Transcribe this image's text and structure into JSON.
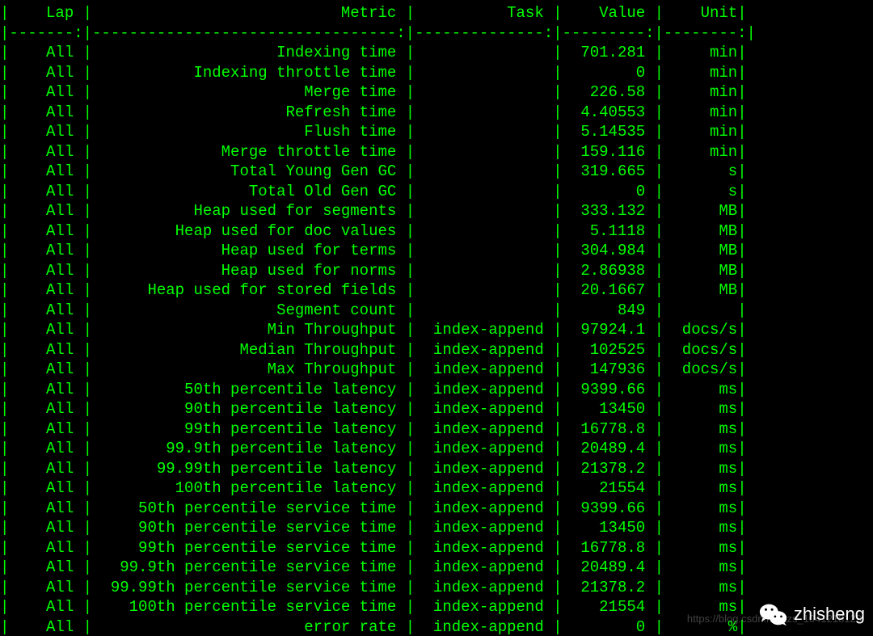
{
  "columns": {
    "lap": {
      "header": "Lap",
      "width": 7,
      "pad_right": 1
    },
    "metric": {
      "header": "Metric",
      "width": 33,
      "pad_right": 1
    },
    "task": {
      "header": "Task",
      "width": 14,
      "pad_right": 1
    },
    "value": {
      "header": "Value",
      "width": 9,
      "pad_right": 1
    },
    "unit": {
      "header": "Unit",
      "width": 8,
      "pad_right": 0
    }
  },
  "rows": [
    {
      "lap": "All",
      "metric": "Indexing time",
      "task": "",
      "value": "701.281",
      "unit": "min"
    },
    {
      "lap": "All",
      "metric": "Indexing throttle time",
      "task": "",
      "value": "0",
      "unit": "min"
    },
    {
      "lap": "All",
      "metric": "Merge time",
      "task": "",
      "value": "226.58",
      "unit": "min"
    },
    {
      "lap": "All",
      "metric": "Refresh time",
      "task": "",
      "value": "4.40553",
      "unit": "min"
    },
    {
      "lap": "All",
      "metric": "Flush time",
      "task": "",
      "value": "5.14535",
      "unit": "min"
    },
    {
      "lap": "All",
      "metric": "Merge throttle time",
      "task": "",
      "value": "159.116",
      "unit": "min"
    },
    {
      "lap": "All",
      "metric": "Total Young Gen GC",
      "task": "",
      "value": "319.665",
      "unit": "s"
    },
    {
      "lap": "All",
      "metric": "Total Old Gen GC",
      "task": "",
      "value": "0",
      "unit": "s"
    },
    {
      "lap": "All",
      "metric": "Heap used for segments",
      "task": "",
      "value": "333.132",
      "unit": "MB"
    },
    {
      "lap": "All",
      "metric": "Heap used for doc values",
      "task": "",
      "value": "5.1118",
      "unit": "MB"
    },
    {
      "lap": "All",
      "metric": "Heap used for terms",
      "task": "",
      "value": "304.984",
      "unit": "MB"
    },
    {
      "lap": "All",
      "metric": "Heap used for norms",
      "task": "",
      "value": "2.86938",
      "unit": "MB"
    },
    {
      "lap": "All",
      "metric": "Heap used for stored fields",
      "task": "",
      "value": "20.1667",
      "unit": "MB"
    },
    {
      "lap": "All",
      "metric": "Segment count",
      "task": "",
      "value": "849",
      "unit": ""
    },
    {
      "lap": "All",
      "metric": "Min Throughput",
      "task": "index-append",
      "value": "97924.1",
      "unit": "docs/s"
    },
    {
      "lap": "All",
      "metric": "Median Throughput",
      "task": "index-append",
      "value": "102525",
      "unit": "docs/s"
    },
    {
      "lap": "All",
      "metric": "Max Throughput",
      "task": "index-append",
      "value": "147936",
      "unit": "docs/s"
    },
    {
      "lap": "All",
      "metric": "50th percentile latency",
      "task": "index-append",
      "value": "9399.66",
      "unit": "ms"
    },
    {
      "lap": "All",
      "metric": "90th percentile latency",
      "task": "index-append",
      "value": "13450",
      "unit": "ms"
    },
    {
      "lap": "All",
      "metric": "99th percentile latency",
      "task": "index-append",
      "value": "16778.8",
      "unit": "ms"
    },
    {
      "lap": "All",
      "metric": "99.9th percentile latency",
      "task": "index-append",
      "value": "20489.4",
      "unit": "ms"
    },
    {
      "lap": "All",
      "metric": "99.99th percentile latency",
      "task": "index-append",
      "value": "21378.2",
      "unit": "ms"
    },
    {
      "lap": "All",
      "metric": "100th percentile latency",
      "task": "index-append",
      "value": "21554",
      "unit": "ms"
    },
    {
      "lap": "All",
      "metric": "50th percentile service time",
      "task": "index-append",
      "value": "9399.66",
      "unit": "ms"
    },
    {
      "lap": "All",
      "metric": "90th percentile service time",
      "task": "index-append",
      "value": "13450",
      "unit": "ms"
    },
    {
      "lap": "All",
      "metric": "99th percentile service time",
      "task": "index-append",
      "value": "16778.8",
      "unit": "ms"
    },
    {
      "lap": "All",
      "metric": "99.9th percentile service time",
      "task": "index-append",
      "value": "20489.4",
      "unit": "ms"
    },
    {
      "lap": "All",
      "metric": "99.99th percentile service time",
      "task": "index-append",
      "value": "21378.2",
      "unit": "ms"
    },
    {
      "lap": "All",
      "metric": "100th percentile service time",
      "task": "index-append",
      "value": "21554",
      "unit": "ms"
    },
    {
      "lap": "All",
      "metric": "error rate",
      "task": "index-append",
      "value": "0",
      "unit": "%"
    }
  ],
  "watermark": {
    "label": "zhisheng",
    "url": "https://blog.csdn.net/tzs_1041218129"
  }
}
